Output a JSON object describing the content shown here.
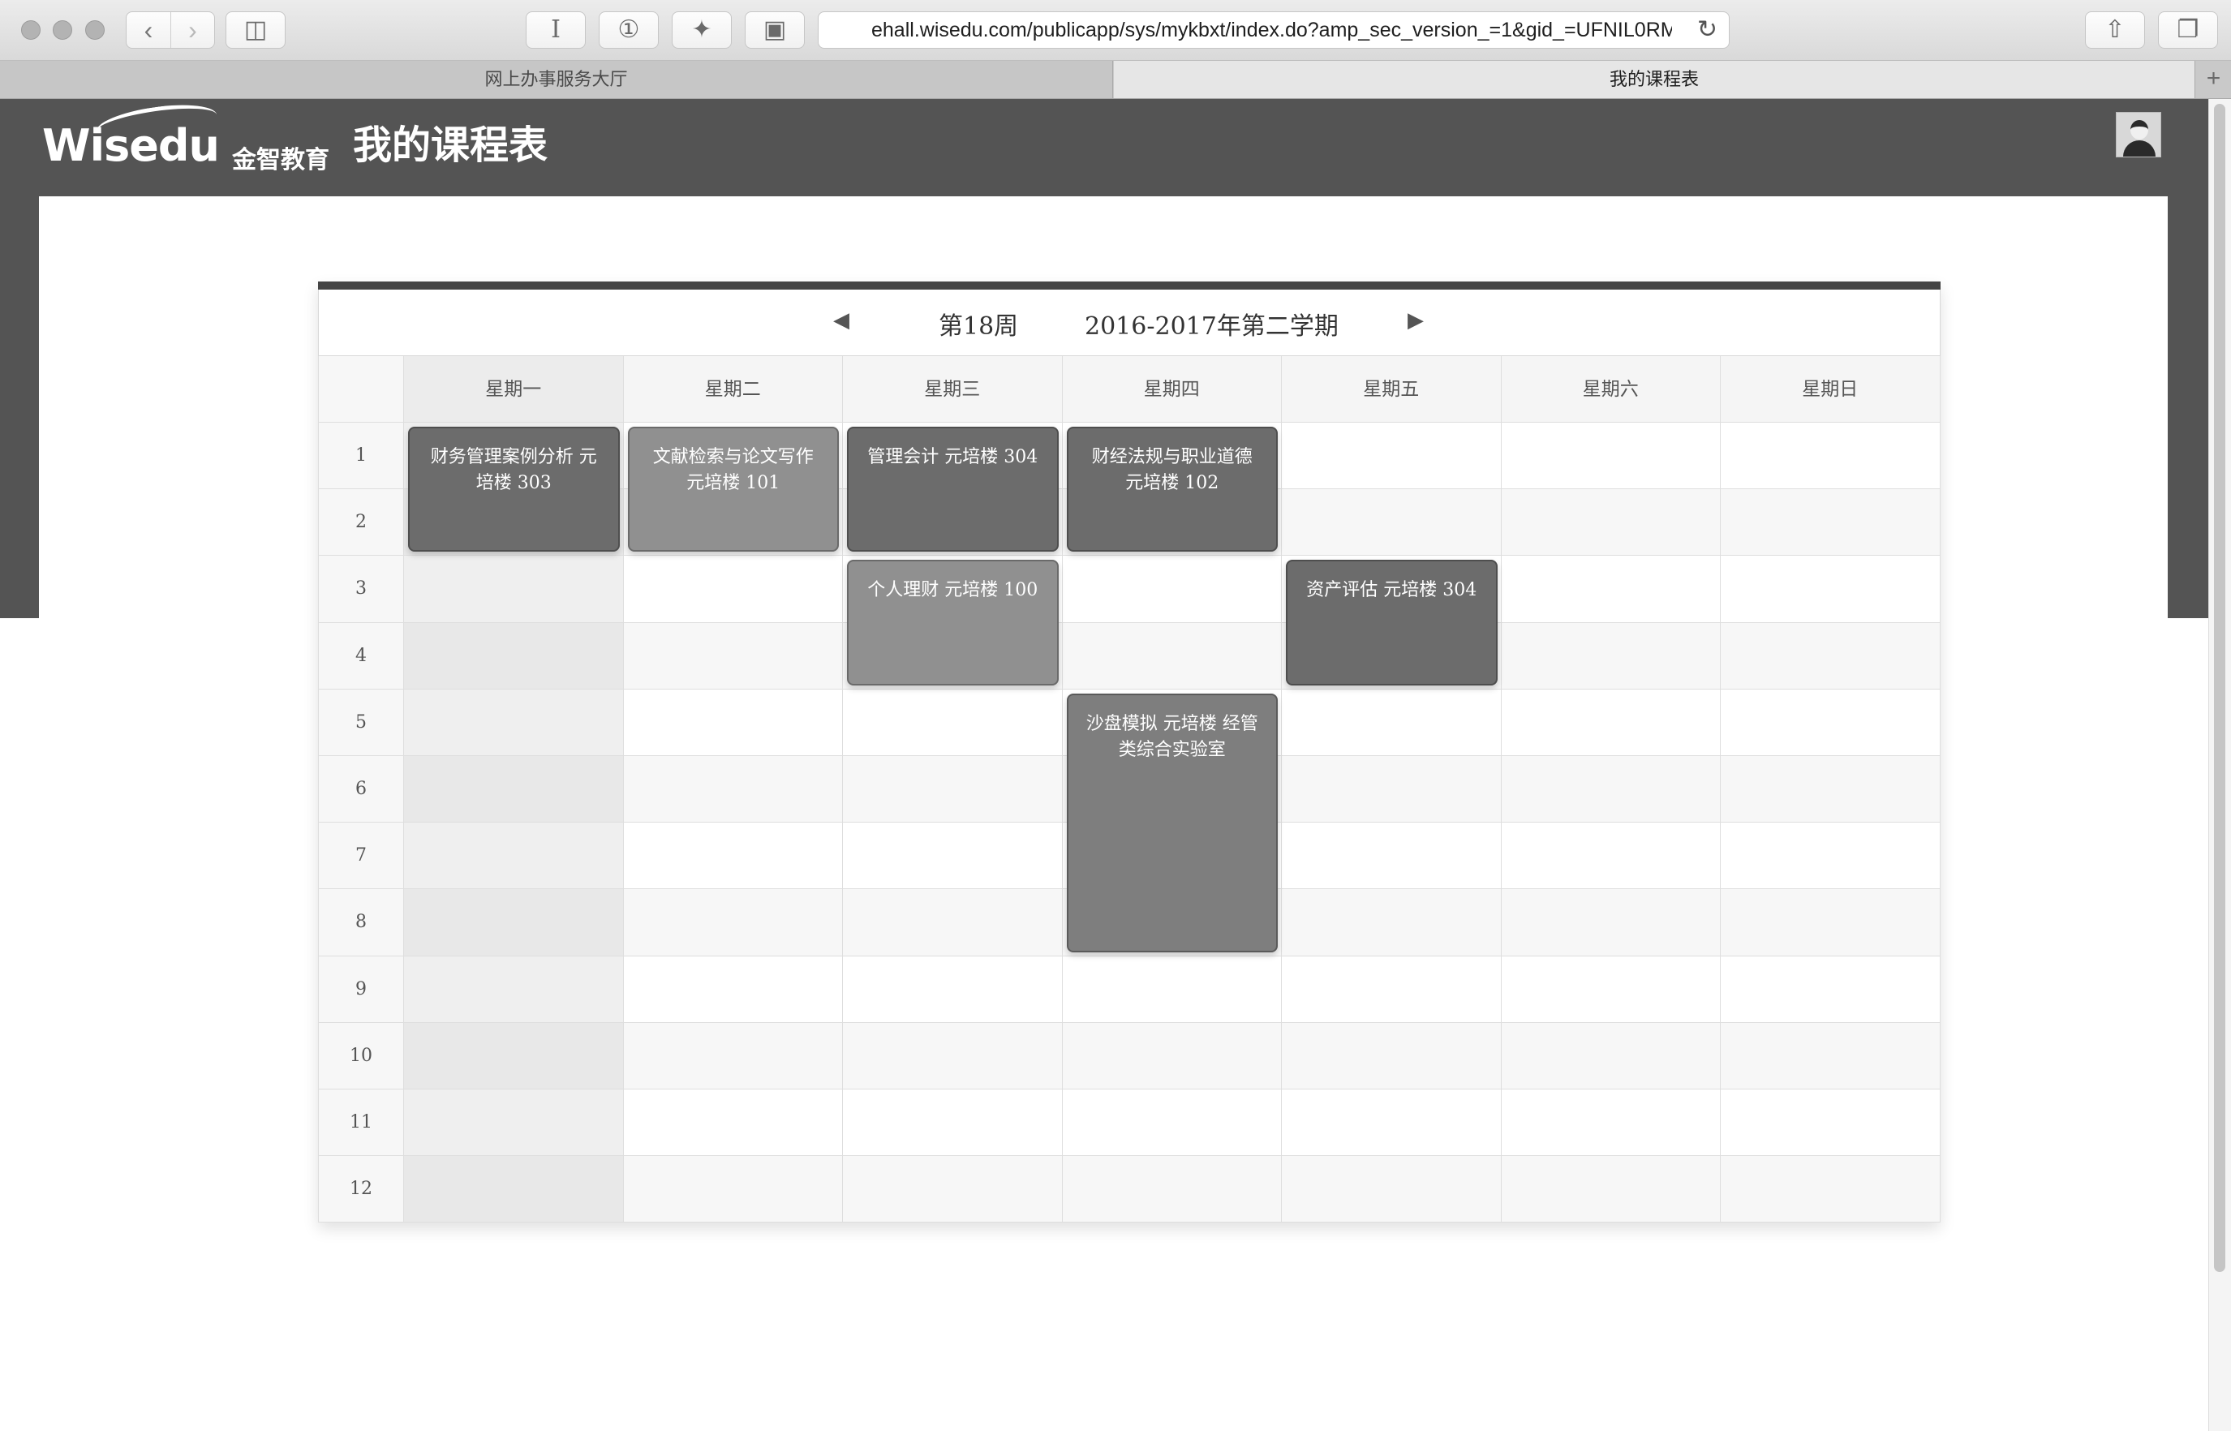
{
  "browser": {
    "url": "ehall.wisedu.com/publicapp/sys/mykbxt/index.do?amp_sec_version_=1&gid_=UFNIL0RM",
    "tabs": [
      {
        "label": "网上办事服务大厅",
        "active": false
      },
      {
        "label": "我的课程表",
        "active": true
      }
    ],
    "reader_label": "I",
    "onepassword_label": "①",
    "new_tab_label": "+"
  },
  "header": {
    "logo_text": "Wisedu",
    "logo_cn": "金智教育",
    "title": "我的课程表"
  },
  "timetable": {
    "week_label": "第18周",
    "term_label": "2016-2017年第二学期",
    "days": [
      "星期一",
      "星期二",
      "星期三",
      "星期四",
      "星期五",
      "星期六",
      "星期日"
    ],
    "periods": [
      "1",
      "2",
      "3",
      "4",
      "5",
      "6",
      "7",
      "8",
      "9",
      "10",
      "11",
      "12"
    ],
    "courses": [
      {
        "text": "财务管理案例分析 元培楼 303",
        "day": 1,
        "start": 1,
        "end": 2,
        "shade": "dark"
      },
      {
        "text": "文献检索与论文写作 元培楼 101",
        "day": 2,
        "start": 1,
        "end": 2,
        "shade": "light"
      },
      {
        "text": "管理会计 元培楼 304",
        "day": 3,
        "start": 1,
        "end": 2,
        "shade": "dark"
      },
      {
        "text": "财经法规与职业道德 元培楼 102",
        "day": 4,
        "start": 1,
        "end": 2,
        "shade": "dark"
      },
      {
        "text": "个人理财 元培楼 100",
        "day": 3,
        "start": 3,
        "end": 4,
        "shade": "light"
      },
      {
        "text": "资产评估 元培楼 304",
        "day": 5,
        "start": 3,
        "end": 4,
        "shade": "dark"
      },
      {
        "text": "沙盘模拟 元培楼 经管类综合实验室",
        "day": 4,
        "start": 5,
        "end": 8,
        "shade": "mid"
      }
    ]
  },
  "colors": {
    "header_band": "#545454",
    "timetable_top_border": "#444444",
    "course_dark": "#6c6c6c",
    "course_light": "#909090"
  }
}
